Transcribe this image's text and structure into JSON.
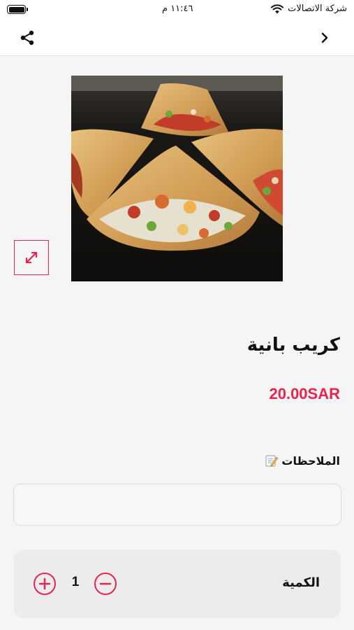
{
  "status_bar": {
    "carrier": "شركة الاتصالات",
    "time": "١١:٤٦ م",
    "battery_level": 1.0
  },
  "nav": {
    "share_icon": "share-icon",
    "back_icon": "chevron-right-icon"
  },
  "product": {
    "name": "كريب بانية",
    "price": "20.00SAR",
    "expand_icon": "expand-icon"
  },
  "notes": {
    "label": "الملاحظات",
    "icon": "memo-icon",
    "value": "",
    "placeholder": ""
  },
  "quantity": {
    "label": "الكمية",
    "value": "1",
    "plus_icon": "plus-circle-icon",
    "minus_icon": "minus-circle-icon"
  },
  "colors": {
    "accent": "#e8244f",
    "background": "#f5f5f5",
    "card": "#ececec"
  }
}
